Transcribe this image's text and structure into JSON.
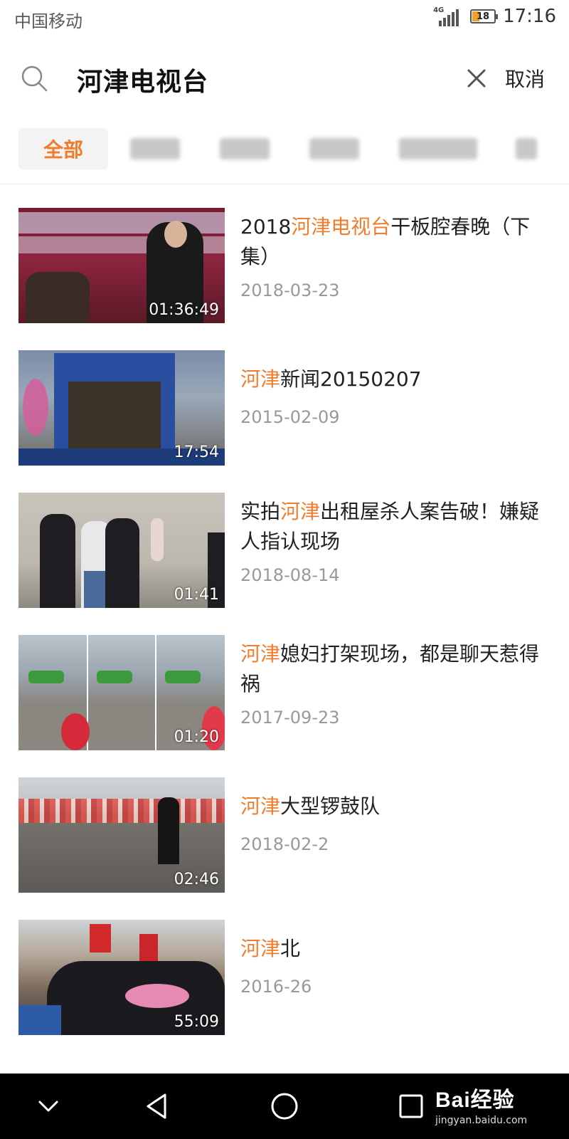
{
  "status_bar": {
    "carrier": "中国移动",
    "network": "4G",
    "battery_level": "18",
    "time": "17:16"
  },
  "search": {
    "icon": "search-icon",
    "query": "河津电视台",
    "clear_icon": "close-icon",
    "cancel_label": "取消"
  },
  "tabs": [
    {
      "label": "全部",
      "active": true
    }
  ],
  "results": [
    {
      "title_prefix": "2018",
      "title_highlight": "河津电视台",
      "title_suffix": "干板腔春晚（下集）",
      "date": "2018-03-23",
      "duration": "01:36:49"
    },
    {
      "title_prefix": "",
      "title_highlight": "河津",
      "title_suffix": "新闻20150207",
      "date": "2015-02-09",
      "duration": "17:54"
    },
    {
      "title_prefix": "实拍",
      "title_highlight": "河津",
      "title_suffix": "出租屋杀人案告破！嫌疑人指认现场",
      "date": "2018-08-14",
      "duration": "01:41"
    },
    {
      "title_prefix": "",
      "title_highlight": "河津",
      "title_suffix": "媳妇打架现场，都是聊天惹得祸",
      "date": "2017-09-23",
      "duration": "01:20"
    },
    {
      "title_prefix": "",
      "title_highlight": "河津",
      "title_suffix": "大型锣鼓队",
      "date": "2018-02-2",
      "duration": "02:46"
    },
    {
      "title_prefix": "",
      "title_highlight": "河津",
      "title_suffix": "北",
      "date": "2016-26",
      "duration": "55:09"
    }
  ],
  "watermark": {
    "main": "Bai经验",
    "sub": "jingyan.baidu.com"
  },
  "colors": {
    "highlight": "#f07d2e",
    "date_gray": "#999999",
    "nav_bg": "#000000"
  }
}
